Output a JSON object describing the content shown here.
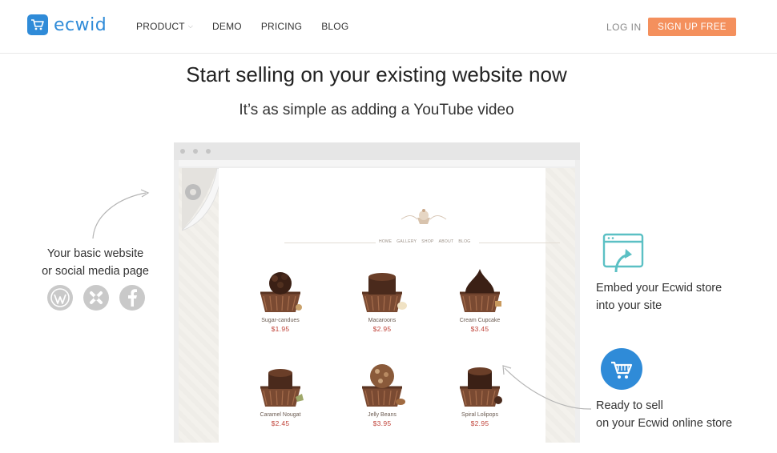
{
  "header": {
    "logo_text": "ecwid",
    "nav": [
      {
        "label": "PRODUCT",
        "has_dropdown": true
      },
      {
        "label": "DEMO"
      },
      {
        "label": "PRICING"
      },
      {
        "label": "BLOG"
      }
    ],
    "login_label": "LOG IN",
    "signup_label": "SIGN UP FREE"
  },
  "hero": {
    "title": "Start selling on your existing website now",
    "subtitle": "It’s as simple as adding a YouTube video"
  },
  "mockup": {
    "site_nav": [
      "HOME",
      "GALLERY",
      "SHOP",
      "ABOUT",
      "BLOG"
    ],
    "products": [
      {
        "name": "Sugar-candues",
        "price": "$1.95"
      },
      {
        "name": "Macaroons",
        "price": "$2.95"
      },
      {
        "name": "Cream Cupcake",
        "price": "$3.45"
      },
      {
        "name": "Caramel Nougat",
        "price": "$2.45"
      },
      {
        "name": "Jelly Beans",
        "price": "$3.95"
      },
      {
        "name": "Spiral Lolipops",
        "price": "$2.95"
      }
    ]
  },
  "left_note": {
    "line1": "Your basic website",
    "line2": "or social media page",
    "icons": [
      "wordpress-icon",
      "joomla-icon",
      "facebook-icon"
    ]
  },
  "embed_note": {
    "line1": "Embed your Ecwid store",
    "line2": "into your site"
  },
  "ready_note": {
    "line1": "Ready to sell",
    "line2": "on your Ecwid online store"
  },
  "colors": {
    "brand": "#2f8bd8",
    "signup": "#f4905d",
    "embed_icon": "#5bc0c4",
    "price": "#c0443a"
  }
}
